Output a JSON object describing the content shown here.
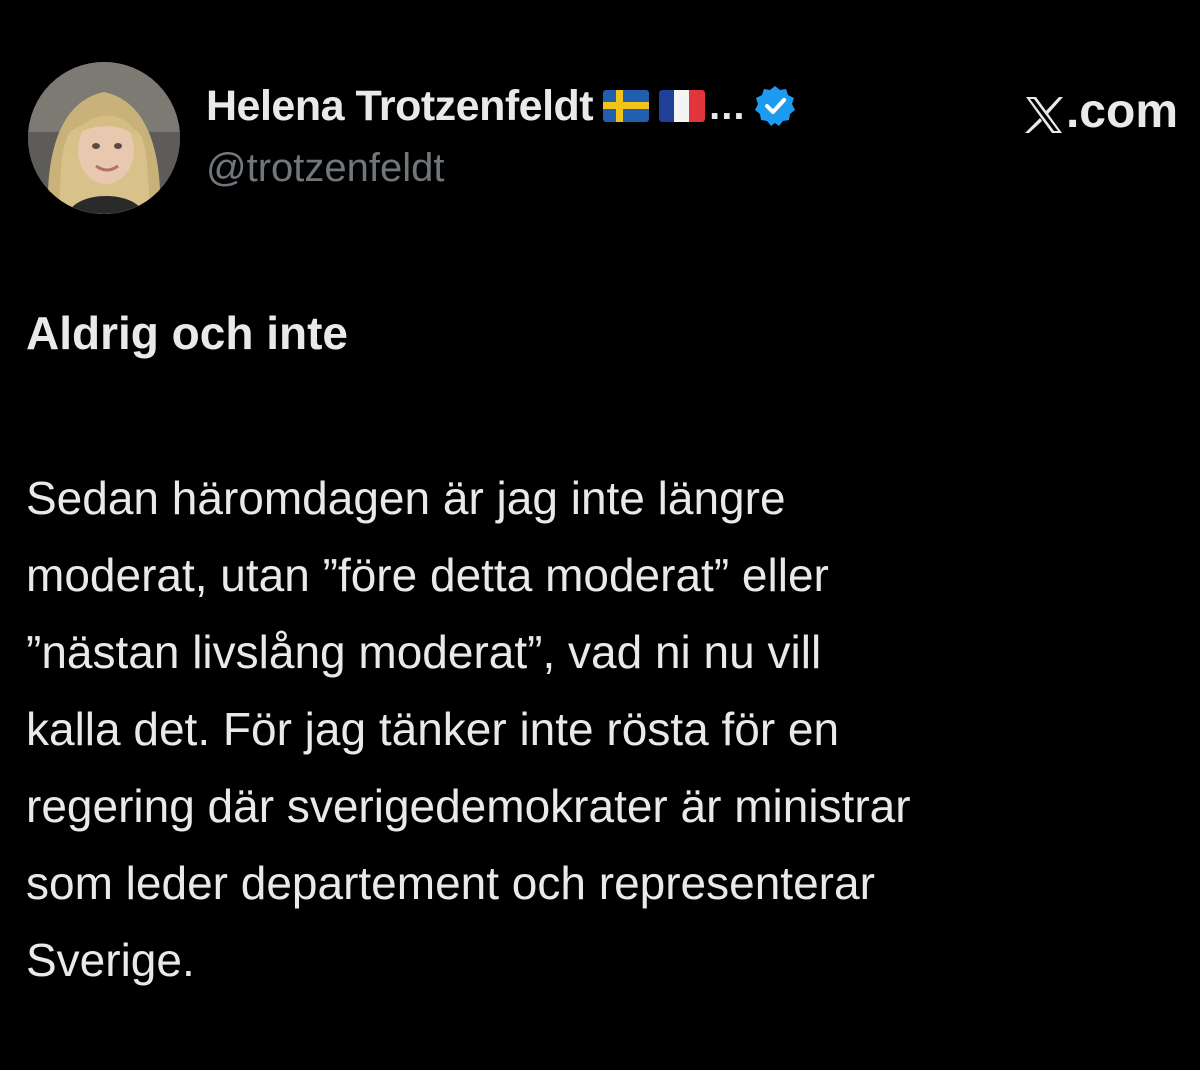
{
  "tweet": {
    "author": {
      "display_name": "Helena Trotzenfeldt",
      "handle": "@trotzenfeldt",
      "flags": [
        "sweden-flag-icon",
        "france-flag-icon"
      ],
      "truncation": "...",
      "verified_icon": "verified-badge-icon"
    },
    "brand": {
      "logo": "x-logo-icon",
      "label": ".com"
    },
    "title": "Aldrig och inte",
    "body_lines": [
      "Sedan häromdagen är jag inte längre",
      "moderat, utan ”före detta moderat” eller",
      "”nästan livslång moderat”, vad ni nu vill",
      "kalla det. För jag tänker inte rösta för en",
      "regering där sverigedemokrater är ministrar",
      "som leder departement och representerar",
      "Sverige."
    ]
  },
  "colors": {
    "background": "#000000",
    "text": "#e7e9ea",
    "muted": "#71767b",
    "verified": "#1d9bf0"
  }
}
